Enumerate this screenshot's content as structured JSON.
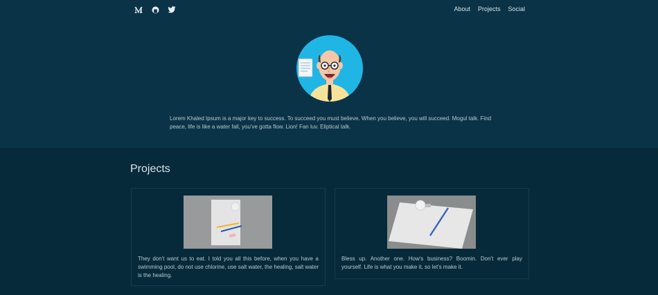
{
  "header": {
    "icons": [
      "medium-icon",
      "github-icon",
      "twitter-icon"
    ],
    "nav": [
      {
        "label": "About"
      },
      {
        "label": "Projects"
      },
      {
        "label": "Social"
      }
    ]
  },
  "hero": {
    "intro": "Lorem Khaled Ipsum is a major key to success. To succeed you must believe. When you believe, you will succeed. Mogul talk. Find peace, life is like a water fall, you've gotta flow. Lion! Fan luv. Eliptical talk."
  },
  "projects": {
    "title": "Projects",
    "cards": [
      {
        "text": "They don't want us to eat. I told you all this before, when you have a swimming pool, do not use chlorine, use salt water, the healing, salt water is the healing."
      },
      {
        "text": "Bless up. Another one. How's business? Boomin. Don't ever play yourself. Life is what you make it, so let's make it."
      }
    ]
  },
  "colors": {
    "hero_bg": "#0b3347",
    "page_bg": "#062a3a",
    "avatar_bg": "#1fb6e6"
  }
}
